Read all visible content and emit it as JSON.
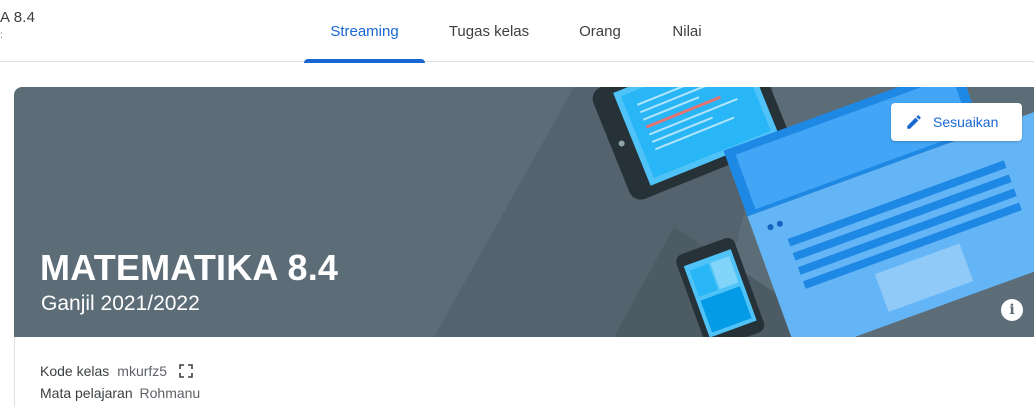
{
  "header": {
    "class_name": "A 8.4",
    "class_sub": ":"
  },
  "tabs": [
    {
      "label": "Streaming",
      "active": true
    },
    {
      "label": "Tugas kelas",
      "active": false
    },
    {
      "label": "Orang",
      "active": false
    },
    {
      "label": "Nilai",
      "active": false
    }
  ],
  "banner": {
    "title": "MATEMATIKA 8.4",
    "subtitle": "Ganjil 2021/2022",
    "customize_label": "Sesuaikan",
    "customize_icon": "pencil-icon",
    "info_icon": "info-icon",
    "info_glyph": "i",
    "background_color": "#5d6d78"
  },
  "class_info": {
    "code_label": "Kode kelas",
    "code_value": "mkurfz5",
    "subject_label": "Mata pelajaran",
    "subject_value": "Rohmanu"
  },
  "colors": {
    "accent": "#1967d2",
    "banner": "#5d6d78"
  }
}
